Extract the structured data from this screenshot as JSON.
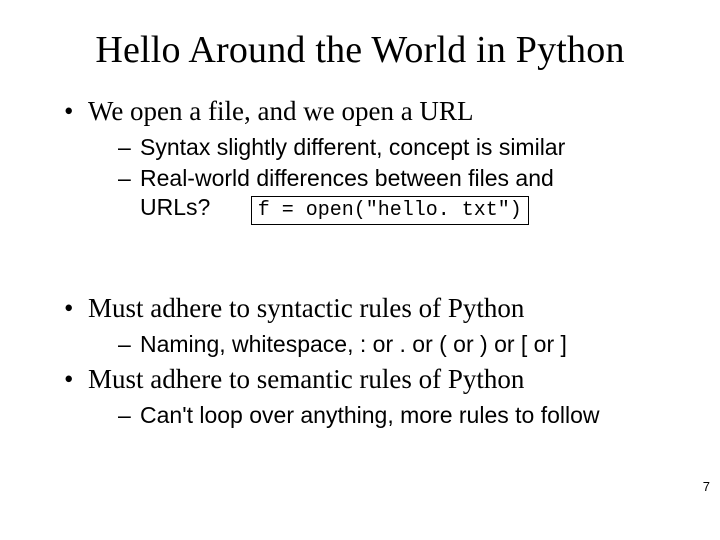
{
  "title": "Hello Around the World in Python",
  "bullets": {
    "b1": {
      "text": "We open a file, and we open a URL",
      "subs": {
        "s1": "Syntax slightly different, concept is similar",
        "s2a": "Real-world differences between files and",
        "s2b": "URLs?"
      }
    },
    "code": "f = open(\"hello. txt\")",
    "b2": {
      "text": "Must adhere to syntactic rules of Python",
      "subs": {
        "s1": "Naming, whitespace, : or . or ( or ) or [ or ]"
      }
    },
    "b3": {
      "text": "Must adhere to semantic rules of Python",
      "subs": {
        "s1": "Can't loop over anything, more rules to follow"
      }
    }
  },
  "page_number": "7"
}
